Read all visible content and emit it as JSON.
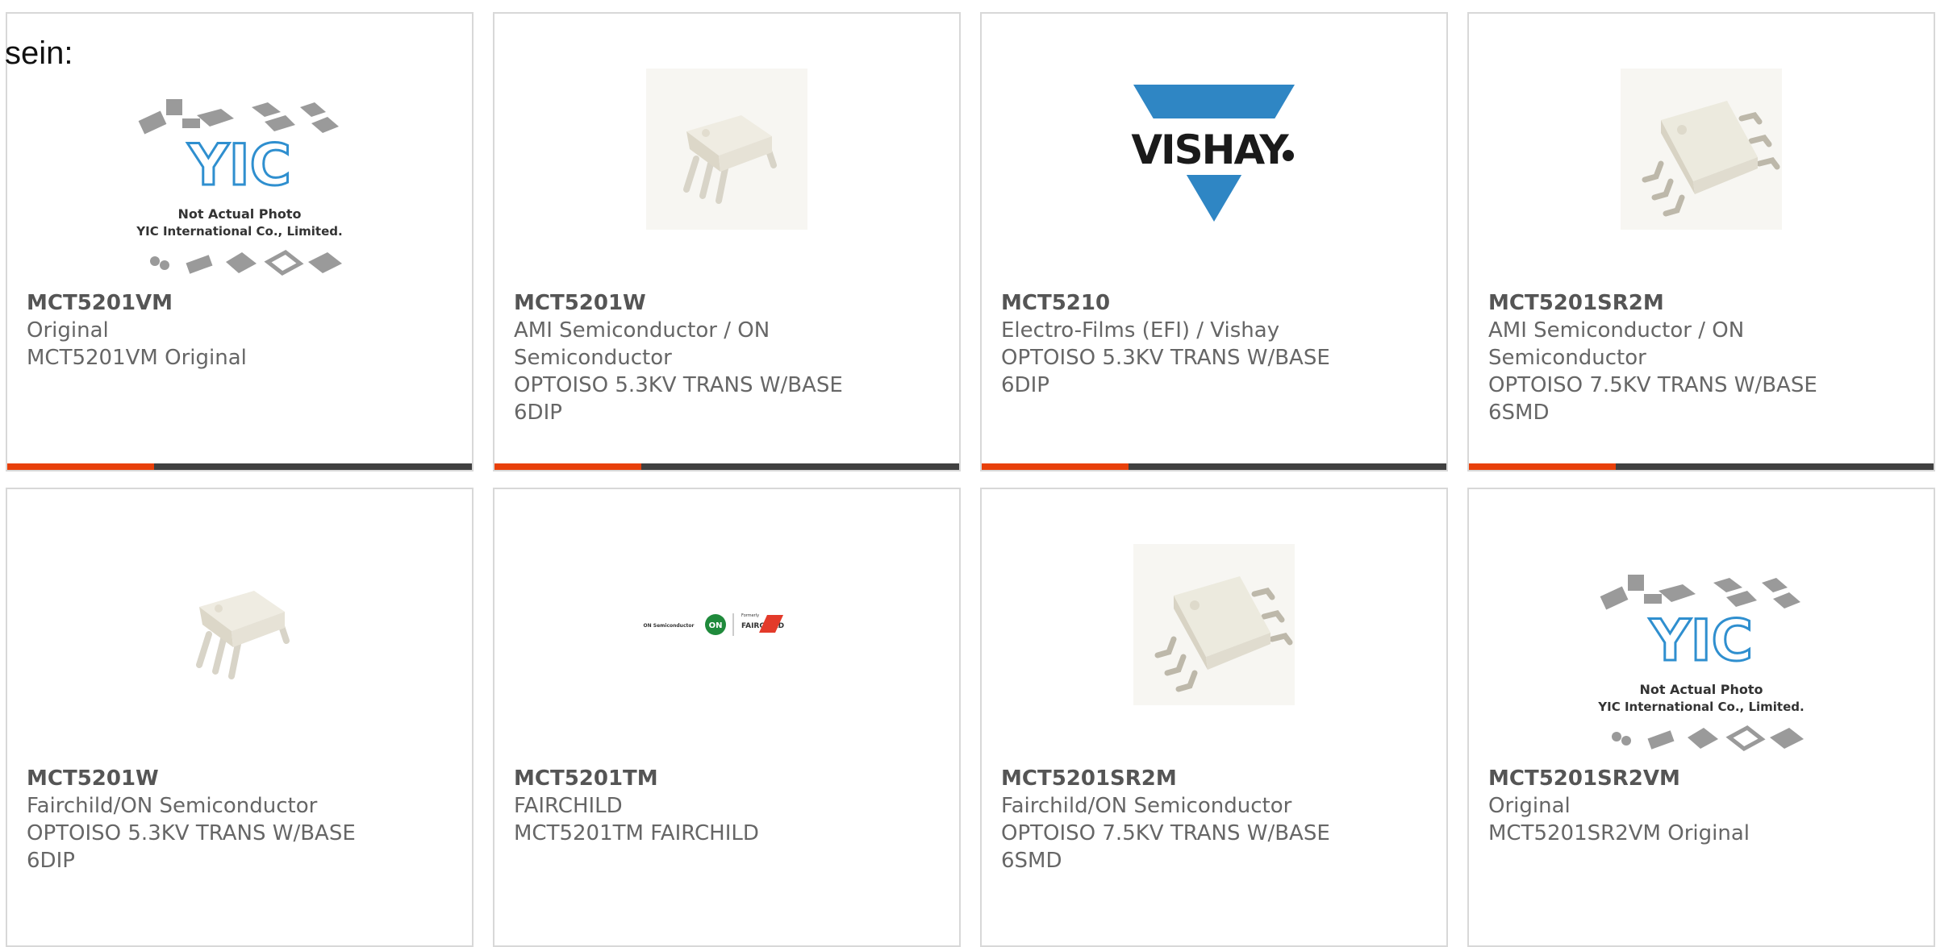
{
  "intro_text": "sein:",
  "accent_color": "#e8400a",
  "bar_color": "#404040",
  "products": [
    {
      "part": "MCT5201VM",
      "manufacturer": "Original",
      "description": "MCT5201VM Original",
      "image": "yic-placeholder",
      "has_bar": true
    },
    {
      "part": "MCT5201W",
      "manufacturer": "AMI Semiconductor / ON Semiconductor",
      "description": "OPTOISO 5.3KV TRANS W/BASE 6DIP",
      "image": "dip6-chip",
      "has_bar": true
    },
    {
      "part": "MCT5210",
      "manufacturer": "Electro-Films (EFI) / Vishay",
      "description": "OPTOISO 5.3KV TRANS W/BASE 6DIP",
      "image": "vishay-logo",
      "logo_text": "VISHAY",
      "has_bar": true
    },
    {
      "part": "MCT5201SR2M",
      "manufacturer": "AMI Semiconductor / ON Semiconductor",
      "description": "OPTOISO 7.5KV TRANS W/BASE 6SMD",
      "image": "smd6-chip",
      "has_bar": true
    },
    {
      "part": "MCT5201W",
      "manufacturer": "Fairchild/ON Semiconductor",
      "description": "OPTOISO 5.3KV TRANS W/BASE 6DIP",
      "image": "dip6-chip",
      "has_bar": false
    },
    {
      "part": "MCT5201TM",
      "manufacturer": "FAIRCHILD",
      "description": "MCT5201TM FAIRCHILD",
      "image": "on-fairchild-logo",
      "has_bar": false
    },
    {
      "part": "MCT5201SR2M",
      "manufacturer": "Fairchild/ON Semiconductor",
      "description": "OPTOISO 7.5KV TRANS W/BASE 6SMD",
      "image": "smd6-chip",
      "has_bar": false
    },
    {
      "part": "MCT5201SR2VM",
      "manufacturer": "Original",
      "description": "MCT5201SR2VM Original",
      "image": "yic-placeholder",
      "has_bar": false
    }
  ],
  "yic_placeholder": {
    "logo_text": "YIC",
    "line1": "Not Actual Photo",
    "line2": "YIC International Co., Limited."
  },
  "on_fairchild": {
    "left_text": "ON Semiconductor",
    "badge_text": "ON",
    "small_text": "Formerly",
    "right_text": "FAIRCHILD"
  }
}
